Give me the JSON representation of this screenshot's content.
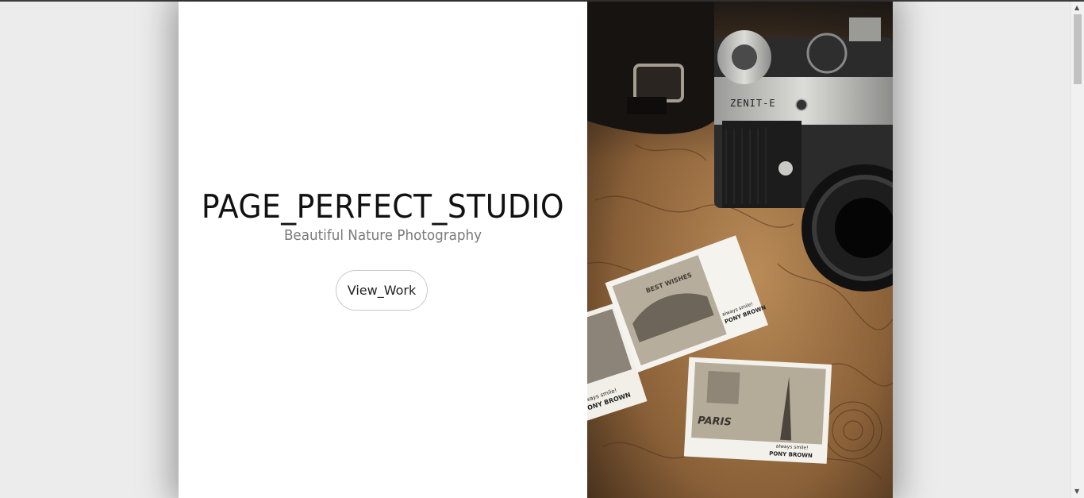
{
  "hero": {
    "title": "PAGE_PERFECT_STUDIO",
    "subtitle": "Beautiful Nature Photography",
    "button_label": "View_Work"
  },
  "photo": {
    "camera_label": "ZENIT-E",
    "postcard_top_heading": "BEST WISHES",
    "postcard_top_caption_1": "always smile!",
    "postcard_top_caption_2": "PONY BROWN",
    "postcard_left_caption_1": "always smile!",
    "postcard_left_caption_2": "PONY BROWN",
    "postcard_bottom_heading": "PARIS",
    "postcard_bottom_caption_1": "always smile!",
    "postcard_bottom_caption_2": "PONY BROWN"
  },
  "scrollbar": {
    "up_icon": "triangle-up",
    "down_icon": "triangle-down"
  }
}
